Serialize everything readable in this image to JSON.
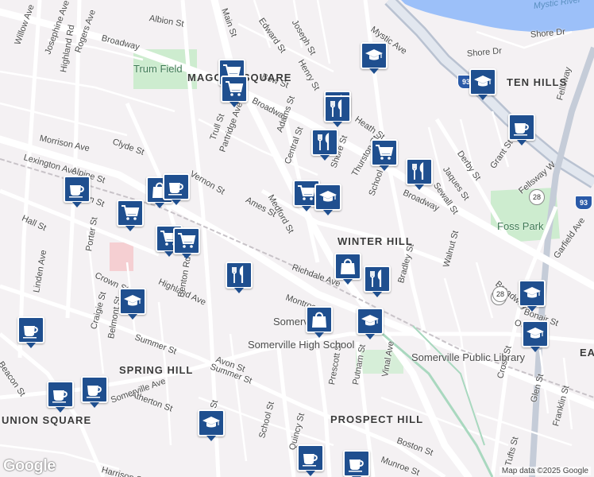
{
  "map": {
    "streets": [
      {
        "name": "Broadway",
        "rot": 14
      },
      {
        "name": "Broadway",
        "rot": 28
      },
      {
        "name": "Broadway",
        "rot": 25
      },
      {
        "name": "Broadway",
        "rot": 40
      },
      {
        "name": "Main St",
        "rot": 70
      },
      {
        "name": "Albion St",
        "rot": 10
      },
      {
        "name": "Edward St",
        "rot": 55
      },
      {
        "name": "Joseph St",
        "rot": 60
      },
      {
        "name": "Henry St",
        "rot": 60
      },
      {
        "name": "Mystic Ave",
        "rot": 35
      },
      {
        "name": "Shore Dr",
        "rot": -5
      },
      {
        "name": "Shore Dr",
        "rot": -5
      },
      {
        "name": "Willow Ave",
        "rot": -70
      },
      {
        "name": "Josephine Ave",
        "rot": -70
      },
      {
        "name": "Rogers Ave",
        "rot": -70
      },
      {
        "name": "Highland Rd",
        "rot": -80
      },
      {
        "name": "Bow St",
        "rot": 20
      },
      {
        "name": "Morrison Ave",
        "rot": 12
      },
      {
        "name": "Lexington Ave",
        "rot": 16
      },
      {
        "name": "Alpine St",
        "rot": 18
      },
      {
        "name": "Albion St",
        "rot": 22
      },
      {
        "name": "Clyde St",
        "rot": 20
      },
      {
        "name": "Trull St",
        "rot": -70
      },
      {
        "name": "Partridge Ave",
        "rot": -70
      },
      {
        "name": "Vernon St",
        "rot": 30
      },
      {
        "name": "Adams St",
        "rot": -70
      },
      {
        "name": "Central St",
        "rot": -70
      },
      {
        "name": "Heath St",
        "rot": 35
      },
      {
        "name": "Shore St",
        "rot": -70
      },
      {
        "name": "Thurston St",
        "rot": -60
      },
      {
        "name": "Medford St",
        "rot": 60
      },
      {
        "name": "Ames St",
        "rot": 28
      },
      {
        "name": "School St",
        "rot": -70
      },
      {
        "name": "Derby St",
        "rot": 55
      },
      {
        "name": "Jaques St",
        "rot": 55
      },
      {
        "name": "Sewall St",
        "rot": 55
      },
      {
        "name": "Grant St",
        "rot": -55
      },
      {
        "name": "Fellsway W",
        "rot": -40
      },
      {
        "name": "Fellsway",
        "rot": -75
      },
      {
        "name": "Hall St",
        "rot": 25
      },
      {
        "name": "Porter St",
        "rot": -80
      },
      {
        "name": "Crown St",
        "rot": 25
      },
      {
        "name": "Linden Ave",
        "rot": -80
      },
      {
        "name": "Highland Ave",
        "rot": 25
      },
      {
        "name": "Richdale Ave",
        "rot": 20
      },
      {
        "name": "Montrose St",
        "rot": 20
      },
      {
        "name": "Bradley St",
        "rot": -75
      },
      {
        "name": "Walnut St",
        "rot": -75
      },
      {
        "name": "Garfield Ave",
        "rot": -55
      },
      {
        "name": "Bonair St",
        "rot": 20
      },
      {
        "name": "Otis St",
        "rot": 15
      },
      {
        "name": "Craigie St",
        "rot": -75
      },
      {
        "name": "Belmont St",
        "rot": -80
      },
      {
        "name": "Benton Rd",
        "rot": -80
      },
      {
        "name": "Summer St",
        "rot": 20
      },
      {
        "name": "Summer St",
        "rot": 20
      },
      {
        "name": "Avon St",
        "rot": 20
      },
      {
        "name": "Atherton St",
        "rot": 20
      },
      {
        "name": "Laurel St",
        "rot": -75
      },
      {
        "name": "Prescott St",
        "rot": -80
      },
      {
        "name": "Putnam St",
        "rot": -80
      },
      {
        "name": "Vinal Ave",
        "rot": -80
      },
      {
        "name": "Beacon St",
        "rot": 55
      },
      {
        "name": "Somerville Ave",
        "rot": -20
      },
      {
        "name": "Harrison St",
        "rot": 15
      },
      {
        "name": "School St",
        "rot": -75
      },
      {
        "name": "Quincy St",
        "rot": -75
      },
      {
        "name": "Boston St",
        "rot": 20
      },
      {
        "name": "Munroe St",
        "rot": 20
      },
      {
        "name": "Cross St",
        "rot": -75
      },
      {
        "name": "Glen St",
        "rot": -75
      },
      {
        "name": "Franklin St",
        "rot": -75
      },
      {
        "name": "Tufts St",
        "rot": -75
      }
    ],
    "neighborhoods": [
      "MAGOUN SQUARE",
      "TEN HILLS",
      "WINTER HILL",
      "SPRING HILL",
      "PROSPECT HILL",
      "EAST SOMERVILLE",
      "UNION SQUARE"
    ],
    "places": [
      "Trum Field",
      "Foss Park"
    ],
    "pois": [
      "Somerville High School",
      "Somerville Public Library",
      "Somerville"
    ],
    "water": "Mystic River",
    "highways": [
      "93",
      "28",
      "28",
      "28",
      "93"
    ],
    "pins": [
      {
        "type": "graduation-cap-icon"
      },
      {
        "type": "graduation-cap-icon"
      },
      {
        "type": "coffee-cup-icon"
      },
      {
        "type": "shopping-cart-icon"
      },
      {
        "type": "shopping-cart-icon"
      },
      {
        "type": "restaurant-icon"
      },
      {
        "type": "restaurant-icon"
      },
      {
        "type": "restaurant-icon"
      },
      {
        "type": "restaurant-icon"
      },
      {
        "type": "shopping-cart-icon"
      },
      {
        "type": "shopping-cart-icon"
      },
      {
        "type": "graduation-cap-icon"
      },
      {
        "type": "shopping-bag-icon"
      },
      {
        "type": "coffee-cup-icon"
      },
      {
        "type": "coffee-cup-icon"
      },
      {
        "type": "shopping-cart-icon"
      },
      {
        "type": "shopping-cart-icon"
      },
      {
        "type": "shopping-cart-icon"
      },
      {
        "type": "restaurant-icon"
      },
      {
        "type": "shopping-bag-icon"
      },
      {
        "type": "restaurant-icon"
      },
      {
        "type": "graduation-cap-icon"
      },
      {
        "type": "graduation-cap-icon"
      },
      {
        "type": "shopping-bag-icon"
      },
      {
        "type": "graduation-cap-icon"
      },
      {
        "type": "graduation-cap-icon"
      },
      {
        "type": "coffee-cup-icon"
      },
      {
        "type": "coffee-cup-icon"
      },
      {
        "type": "coffee-cup-icon"
      },
      {
        "type": "graduation-cap-icon"
      },
      {
        "type": "coffee-cup-icon"
      },
      {
        "type": "coffee-cup-icon"
      }
    ],
    "footer": {
      "logo": "Google",
      "credit": "Map data ©2025 Google"
    }
  }
}
